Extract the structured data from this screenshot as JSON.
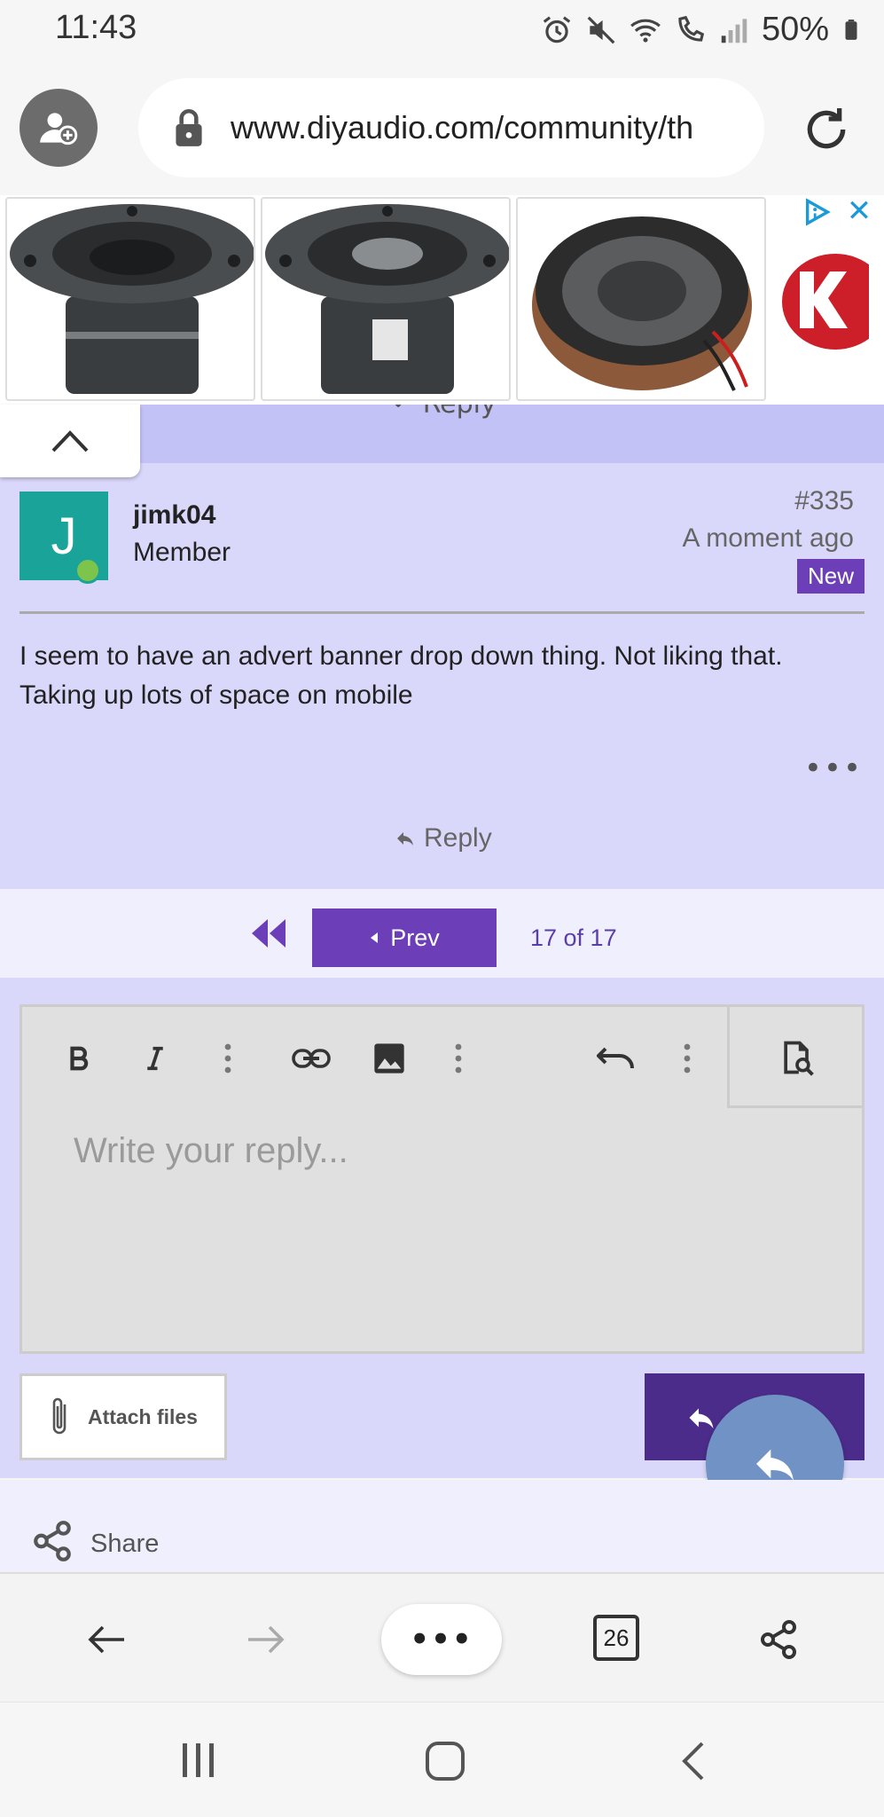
{
  "status_bar": {
    "time": "11:43",
    "battery": "50%"
  },
  "browser": {
    "url": "www.diyaudio.com/community/th",
    "tab_count": "26"
  },
  "ad": {
    "close_glyph": "✕"
  },
  "previous_post": {
    "reply_label": "Reply"
  },
  "post": {
    "avatar_letter": "J",
    "username": "jimk04",
    "role": "Member",
    "number": "#335",
    "time": "A moment ago",
    "badge": "New",
    "body": "I seem to have an advert banner drop down thing. Not liking that. Taking up lots of space on mobile",
    "more_glyph": "•••",
    "reply_label": "Reply"
  },
  "pagination": {
    "prev_label": "Prev",
    "page_count": "17 of 17"
  },
  "editor": {
    "placeholder": "Write your reply...",
    "toolbar_icons": [
      "bold-icon",
      "italic-icon",
      "more-icon",
      "link-icon",
      "image-icon",
      "more-icon",
      "undo-icon",
      "more-icon",
      "preview-icon"
    ]
  },
  "actions": {
    "attach_label": "Attach files"
  },
  "share": {
    "label": "Share"
  },
  "bottom_bar": {
    "menu_glyph": "•••"
  },
  "colors": {
    "content_bg": "#d9d8fa",
    "accent": "#6c3fb8",
    "fab": "#7192c4",
    "avatar_bg": "#1aa398"
  }
}
